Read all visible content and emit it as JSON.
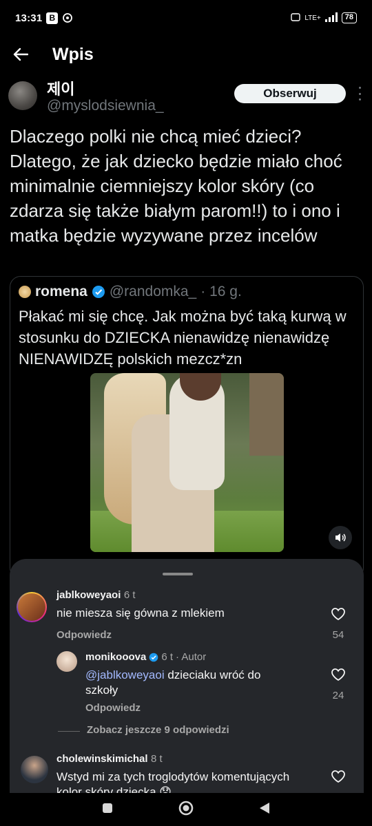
{
  "status_bar": {
    "time": "13:31",
    "b_badge": "B",
    "lte": "LTE+",
    "battery": "78"
  },
  "header": {
    "title": "Wpis"
  },
  "author": {
    "name": "제이",
    "handle": "@myslodsiewnia_",
    "follow_label": "Obserwuj"
  },
  "tweet": {
    "text": "Dlaczego polki nie chcą mieć dzieci? Dlatego, że jak dziecko będzie miało choć minimalnie ciemniejszy kolor skóry (co zdarza się także białym parom!!) to i ono i matka będzie wyzywane przez incelów"
  },
  "quote": {
    "name": "romena",
    "handle": "@randomka_",
    "time": "· 16 g.",
    "text": "Płakać mi się chcę. Jak można być taką kurwą w stosunku do DZIECKA nienawidzę nienawidzę NIENAWIDZĘ polskich mezcz*zn"
  },
  "comments": [
    {
      "user": "jablkoweyaoi",
      "time": "6 t",
      "text": "nie miesza się gówna z mlekiem",
      "reply": "Odpowiedz",
      "likes": "54"
    },
    {
      "user": "monikooova",
      "time": "6 t",
      "author_tag": "· Autor",
      "mention": "@jablkoweyaoi",
      "text": " dzieciaku wróć do szkoły",
      "reply": "Odpowiedz",
      "likes": "24"
    },
    {
      "more_replies": "Zobacz jeszcze 9 odpowiedzi"
    },
    {
      "user": "cholewinskimichal",
      "time": "8 t",
      "text": "Wstyd mi za tych troglodytów komentujących kolor skóry dziecka 😞"
    }
  ],
  "colors": {
    "accent_blue": "#1d9bf0",
    "bg": "#000000",
    "sheet_bg": "#25272b"
  }
}
